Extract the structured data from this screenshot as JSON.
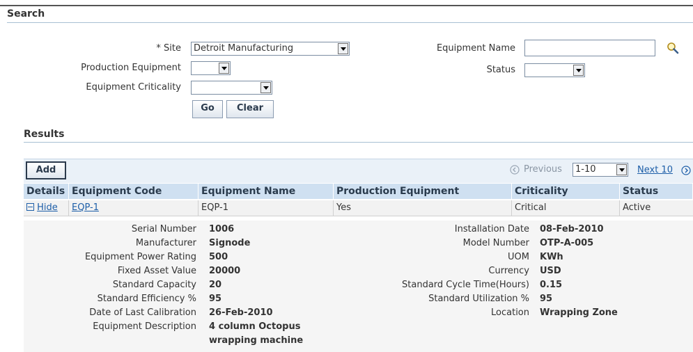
{
  "search": {
    "title": "Search",
    "site_label": "* Site",
    "site_value": "Detroit Manufacturing",
    "production_equipment_label": "Production Equipment",
    "production_equipment_value": "",
    "criticality_label": "Equipment Criticality",
    "criticality_value": "",
    "equipment_name_label": "Equipment Name",
    "equipment_name_value": "",
    "status_label": "Status",
    "status_value": "",
    "go_label": "Go",
    "clear_label": "Clear",
    "search_icon": "magnifier-icon"
  },
  "results": {
    "title": "Results",
    "add_label": "Add",
    "pager": {
      "previous_label": "Previous",
      "range_value": "1-10",
      "next_label": "Next 10"
    },
    "columns": [
      "Details",
      "Equipment Code",
      "Equipment Name",
      "Production Equipment",
      "Criticality",
      "Status"
    ],
    "row": {
      "details": "Hide",
      "code": "EQP-1",
      "name": "EQP-1",
      "production": "Yes",
      "criticality": "Critical",
      "status": "Active"
    },
    "detail_left": [
      {
        "label": "Serial Number",
        "value": "1006"
      },
      {
        "label": "Manufacturer",
        "value": "Signode"
      },
      {
        "label": "Equipment Power Rating",
        "value": "500"
      },
      {
        "label": "Fixed Asset Value",
        "value": "20000"
      },
      {
        "label": "Standard Capacity",
        "value": "20"
      },
      {
        "label": "Standard Efficiency %",
        "value": "95"
      },
      {
        "label": "Date of Last Calibration",
        "value": "26-Feb-2010"
      },
      {
        "label": "Equipment Description",
        "value": "4 column Octopus",
        "value2": "wrapping machine"
      }
    ],
    "detail_right": [
      {
        "label": "Installation Date",
        "value": "08-Feb-2010"
      },
      {
        "label": "Model Number",
        "value": "OTP-A-005"
      },
      {
        "label": "UOM",
        "value": "KWh"
      },
      {
        "label": "Currency",
        "value": "USD"
      },
      {
        "label": "Standard Cycle Time(Hours)",
        "value": "0.15"
      },
      {
        "label": "Standard Utilization %",
        "value": "95"
      },
      {
        "label": "Location",
        "value": "Wrapping Zone"
      }
    ]
  }
}
